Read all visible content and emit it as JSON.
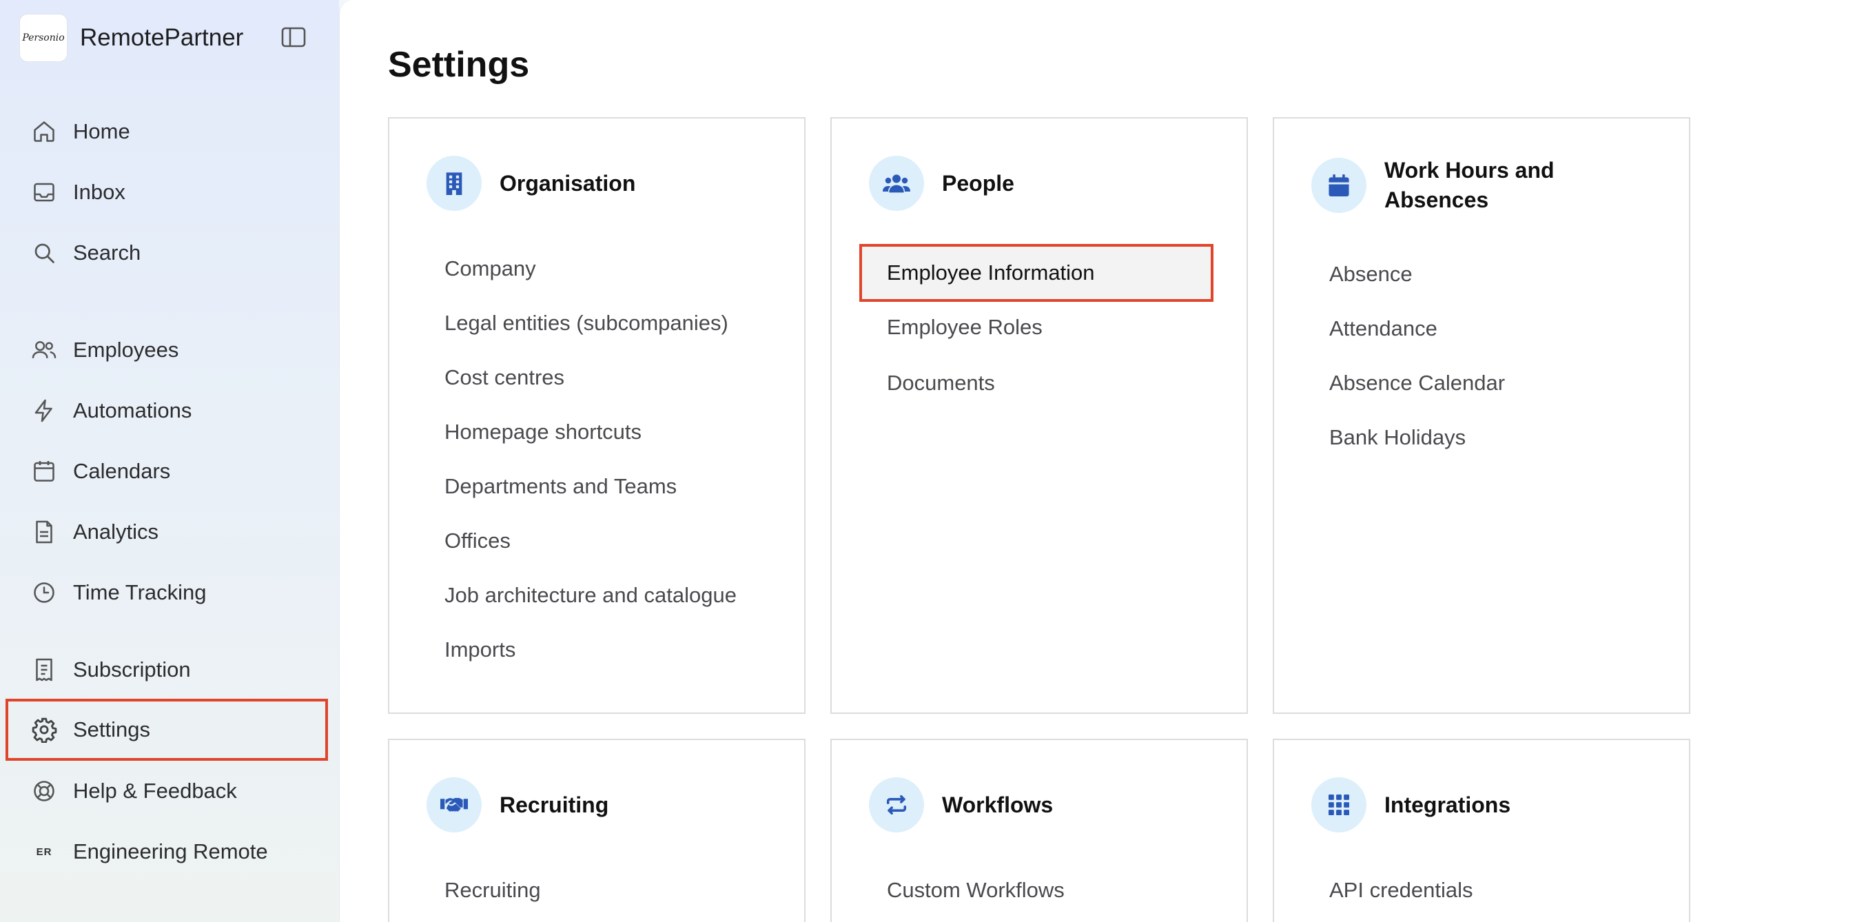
{
  "brand": {
    "logo_text": "Personio",
    "name": "RemotePartner"
  },
  "sidebar": {
    "items": [
      {
        "label": "Home",
        "icon": "home-icon"
      },
      {
        "label": "Inbox",
        "icon": "inbox-icon"
      },
      {
        "label": "Search",
        "icon": "search-icon"
      },
      {
        "label": "Employees",
        "icon": "people-icon"
      },
      {
        "label": "Automations",
        "icon": "lightning-icon"
      },
      {
        "label": "Calendars",
        "icon": "calendar-icon"
      },
      {
        "label": "Analytics",
        "icon": "document-icon"
      },
      {
        "label": "Time Tracking",
        "icon": "clock-icon"
      },
      {
        "label": "Subscription",
        "icon": "receipt-icon"
      },
      {
        "label": "Settings",
        "icon": "gear-icon",
        "selected": true
      },
      {
        "label": "Help & Feedback",
        "icon": "lifebuoy-icon"
      },
      {
        "label": "Engineering Remote",
        "icon": "ER"
      }
    ]
  },
  "main": {
    "title": "Settings",
    "cards": [
      {
        "title": "Organisation",
        "icon": "building-icon",
        "links": [
          "Company",
          "Legal entities (subcompanies)",
          "Cost centres",
          "Homepage shortcuts",
          "Departments and Teams",
          "Offices",
          "Job architecture and catalogue",
          "Imports"
        ]
      },
      {
        "title": "People",
        "icon": "people-group-icon",
        "links": [
          "Employee Information",
          "Employee Roles",
          "Documents"
        ]
      },
      {
        "title": "Work Hours and Absences",
        "icon": "calendar-filled-icon",
        "links": [
          "Absence",
          "Attendance",
          "Absence Calendar",
          "Bank Holidays"
        ]
      },
      {
        "title": "Recruiting",
        "icon": "handshake-icon",
        "links": [
          "Recruiting"
        ]
      },
      {
        "title": "Workflows",
        "icon": "repeat-icon",
        "links": [
          "Custom Workflows"
        ]
      },
      {
        "title": "Integrations",
        "icon": "grid-icon",
        "links": [
          "API credentials"
        ]
      }
    ]
  },
  "colors": {
    "accent": "#2b59b8",
    "highlight_border": "#e0452b",
    "icon_bg": "#dceffb"
  }
}
